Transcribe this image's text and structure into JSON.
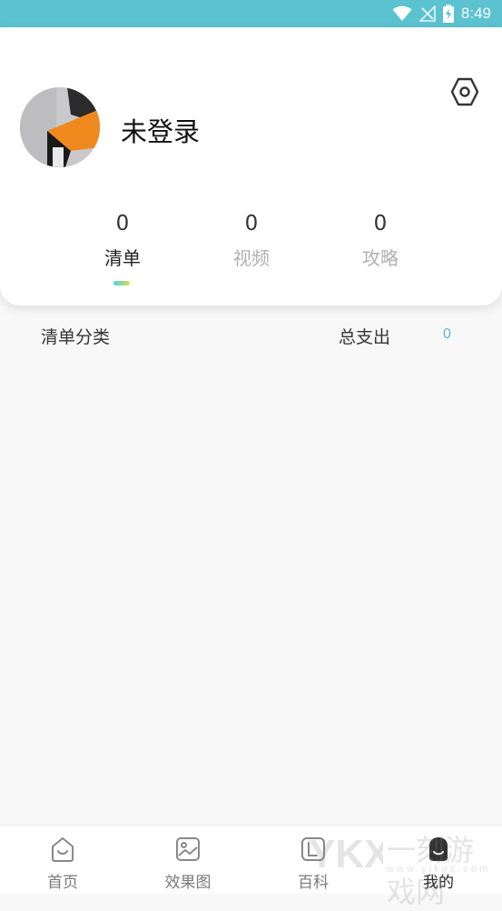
{
  "status_bar": {
    "time": "8:49",
    "icons": [
      "wifi-icon",
      "no-signal-icon",
      "battery-charging-icon"
    ]
  },
  "profile": {
    "username": "未登录",
    "settings_icon": "settings-hexagon-icon"
  },
  "stats_tabs": [
    {
      "count": "0",
      "label": "清单",
      "active": true
    },
    {
      "count": "0",
      "label": "视频",
      "active": false
    },
    {
      "count": "0",
      "label": "攻略",
      "active": false
    }
  ],
  "summary": {
    "category_label": "清单分类",
    "total_label": "总支出",
    "total_value": "0"
  },
  "bottom_nav": [
    {
      "label": "首页",
      "icon": "home-icon",
      "active": false
    },
    {
      "label": "效果图",
      "icon": "image-icon",
      "active": false
    },
    {
      "label": "百科",
      "icon": "book-icon",
      "active": false
    },
    {
      "label": "我的",
      "icon": "profile-icon",
      "active": true
    }
  ],
  "watermark": {
    "text": "一刻游戏网",
    "sub": "www.yikgx.com",
    "logo": "YKX"
  },
  "colors": {
    "accent": "#5bc2d0",
    "total_value": "#5bbad0",
    "indicator_start": "#4bd0e6",
    "indicator_end": "#d6e34a"
  }
}
